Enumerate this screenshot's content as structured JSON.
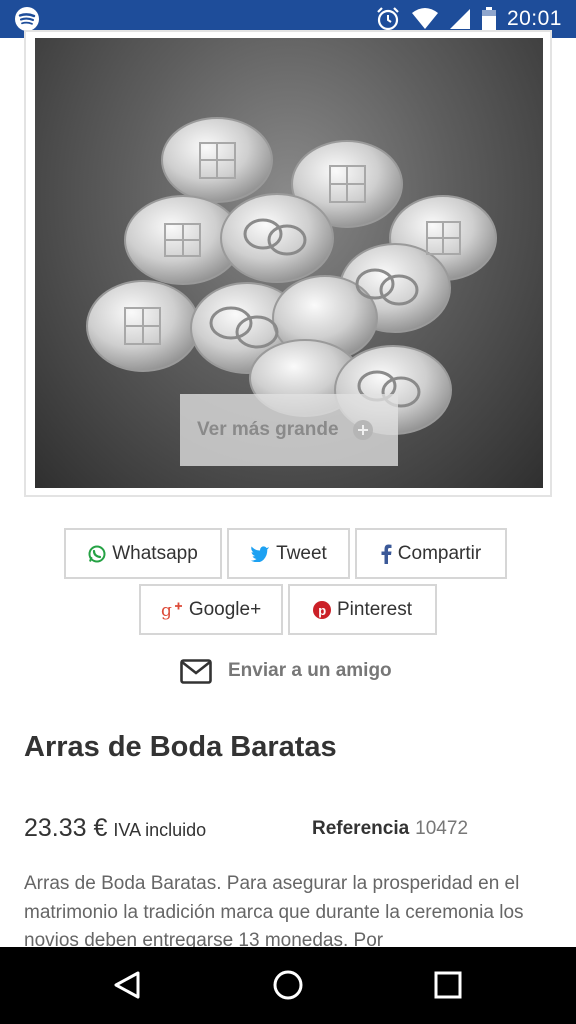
{
  "status_bar": {
    "time": "20:01",
    "icons": [
      "spotify-icon",
      "alarm-icon",
      "wifi-icon",
      "signal-icon",
      "battery-icon"
    ]
  },
  "product": {
    "image_overlay_label": "Ver más grande",
    "title": "Arras de Boda Baratas",
    "price": "23.33 €",
    "tax_label": "IVA incluido",
    "reference_label": "Referencia",
    "reference_value": "10472",
    "description": "Arras de Boda Baratas. Para asegurar la prosperidad en el matrimonio la tradición  marca que durante la ceremonia los novios deben entregarse 13 monedas. Por"
  },
  "share": {
    "whatsapp": "Whatsapp",
    "tweet": "Tweet",
    "compartir": "Compartir",
    "google": "Google+",
    "pinterest": "Pinterest",
    "send_friend": "Enviar a un amigo"
  },
  "colors": {
    "status_bar": "#1e4d9a",
    "whatsapp": "#25a244",
    "twitter": "#1da1f2",
    "facebook": "#3b5998",
    "google": "#dd4b39",
    "pinterest": "#cb2027"
  }
}
